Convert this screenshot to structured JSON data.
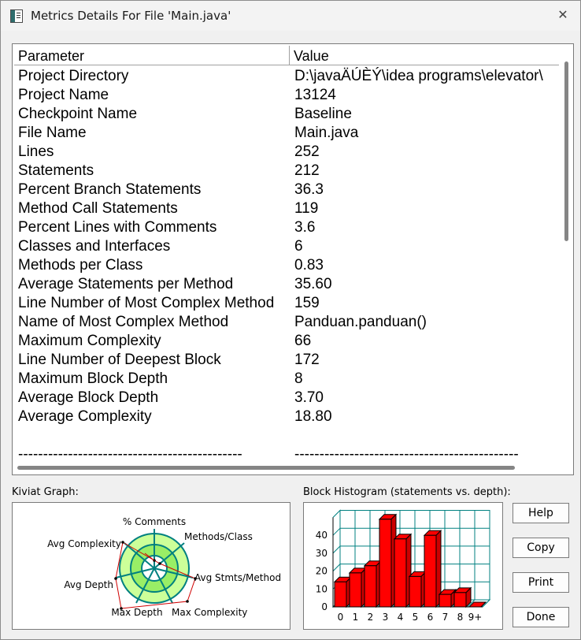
{
  "window": {
    "title": "Metrics Details For File 'Main.java'",
    "icon": "app-window-icon",
    "close_glyph": "✕"
  },
  "table": {
    "columns": [
      "Parameter",
      "Value"
    ],
    "rows": [
      {
        "param": "Project Directory",
        "value": "D:\\javaÄÚÈÝ\\idea  programs\\elevator\\"
      },
      {
        "param": "Project Name",
        "value": "13124"
      },
      {
        "param": "Checkpoint Name",
        "value": "Baseline"
      },
      {
        "param": "File Name",
        "value": "Main.java"
      },
      {
        "param": "Lines",
        "value": "252"
      },
      {
        "param": "Statements",
        "value": "212"
      },
      {
        "param": "Percent Branch Statements",
        "value": "36.3"
      },
      {
        "param": "Method Call Statements",
        "value": "119"
      },
      {
        "param": "Percent Lines with Comments",
        "value": "3.6"
      },
      {
        "param": "Classes and Interfaces",
        "value": "6"
      },
      {
        "param": "Methods per Class",
        "value": "0.83"
      },
      {
        "param": "Average Statements per Method",
        "value": "35.60"
      },
      {
        "param": "Line Number of Most Complex Method",
        "value": "159"
      },
      {
        "param": "Name of Most Complex Method",
        "value": "Panduan.panduan()"
      },
      {
        "param": "Maximum Complexity",
        "value": "66"
      },
      {
        "param": "Line Number of Deepest Block",
        "value": "172"
      },
      {
        "param": "Maximum Block Depth",
        "value": "8"
      },
      {
        "param": "Average Block Depth",
        "value": "3.70"
      },
      {
        "param": "Average Complexity",
        "value": "18.80"
      }
    ],
    "separator_param": "---------------------------------------------",
    "separator_value": "---------------------------------------------"
  },
  "kiviat": {
    "label": "Kiviat Graph:",
    "axes": [
      "% Comments",
      "Methods/Class",
      "Avg Stmts/Method",
      "Max Complexity",
      "Max Depth",
      "Avg Depth",
      "Avg Complexity"
    ]
  },
  "histogram": {
    "label": "Block Histogram (statements vs. depth):"
  },
  "chart_data": {
    "type": "bar",
    "title": "Block Histogram (statements vs. depth):",
    "categories": [
      "0",
      "1",
      "2",
      "3",
      "4",
      "5",
      "6",
      "7",
      "8",
      "9+"
    ],
    "values": [
      14,
      19,
      23,
      49,
      38,
      17,
      40,
      7,
      8,
      0
    ],
    "ylim": [
      0,
      50
    ],
    "yticks": [
      "0",
      "10",
      "20",
      "30",
      "40"
    ],
    "bar_color": "#ff0000",
    "grid_color": "#008080",
    "grid": true
  },
  "buttons": {
    "help": "Help",
    "copy": "Copy",
    "print": "Print",
    "done": "Done"
  }
}
